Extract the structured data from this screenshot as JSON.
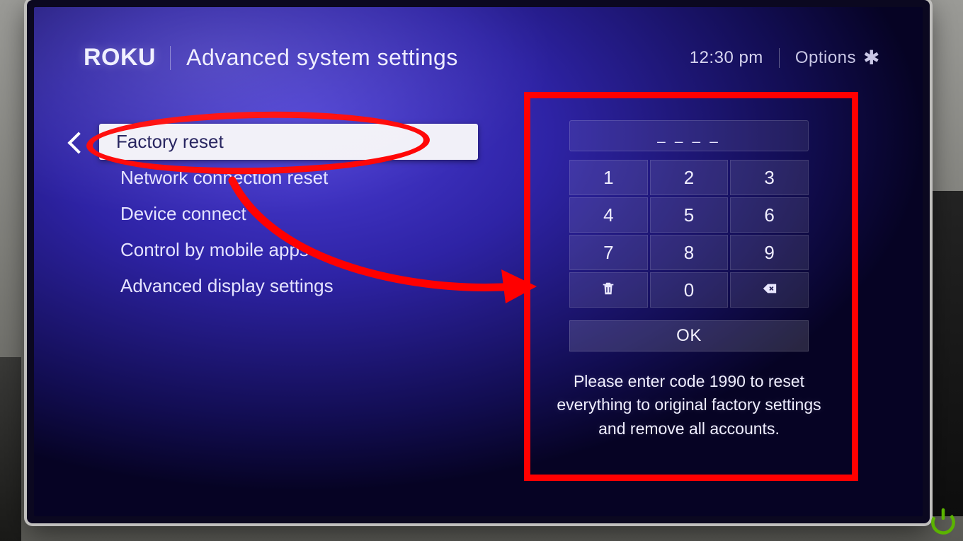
{
  "header": {
    "logo": "ROKU",
    "title": "Advanced system settings",
    "time": "12:30 pm",
    "options_label": "Options"
  },
  "menu": {
    "items": [
      {
        "label": "Factory reset",
        "selected": true
      },
      {
        "label": "Network connection reset",
        "selected": false
      },
      {
        "label": "Device connect",
        "selected": false
      },
      {
        "label": "Control by mobile apps",
        "selected": false
      },
      {
        "label": "Advanced display settings",
        "selected": false
      }
    ]
  },
  "keypad": {
    "pin_placeholder": "_ _ _ _",
    "keys": [
      "1",
      "2",
      "3",
      "4",
      "5",
      "6",
      "7",
      "8",
      "9",
      "trash",
      "0",
      "backspace"
    ],
    "ok_label": "OK",
    "instruction": "Please enter code 1990 to reset everything to original factory settings and remove all accounts."
  }
}
